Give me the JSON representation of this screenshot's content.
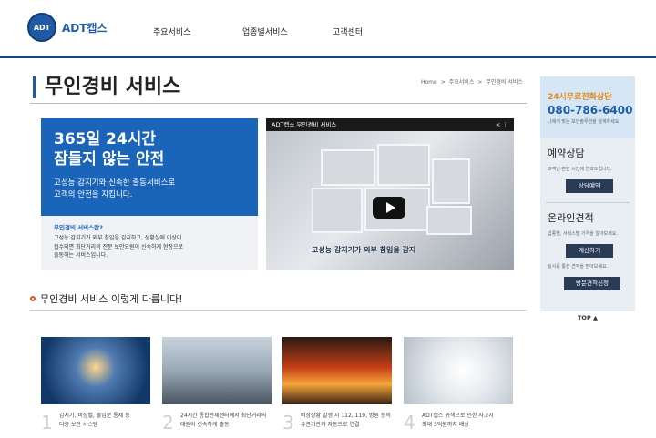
{
  "header": {
    "logo_badge": "ADT",
    "logo_text": "ADT캡스",
    "nav": [
      "주요서비스",
      "업종별서비스",
      "고객센터"
    ]
  },
  "page": {
    "title": "무인경비 서비스",
    "breadcrumb": [
      "Home",
      ">",
      "주요서비스",
      ">",
      "무인경비 서비스"
    ]
  },
  "promo": {
    "headline_line1": "365일 24시간",
    "headline_line2": "잠들지 않는 안전",
    "sub_line1": "고성능 감지기와 신속한 출동서비스로",
    "sub_line2": "고객의 안전을 지킵니다.",
    "question": "무인경비 서비스란?",
    "desc_line1": "고성능 감지기가 외부 침입을 감지하고, 상황실에 이상이",
    "desc_line2": "접수되면 최단거리의 전문 보안요원이 신속하게 현장으로",
    "desc_line3": "출동하는 서비스입니다."
  },
  "video": {
    "title": "ADT캡스 무인경비 서비스",
    "caption": "고성능 감지기가 외부 침입을 감지"
  },
  "section": {
    "title": "무인경비 서비스 이렇게 다릅니다!"
  },
  "features": [
    {
      "num": "1",
      "line1": "감지기, 비상벨, 출입문 통제 등",
      "line2": "다중 보안 시스템"
    },
    {
      "num": "2",
      "line1": "24시간 통합관제센터에서 최단거리의",
      "line2": "대원이 신속하게 출동"
    },
    {
      "num": "3",
      "line1": "비상상황 발생 시 112, 119, 병원 등의",
      "line2": "유관기관과 자동으로 연결"
    },
    {
      "num": "4",
      "line1": "ADT캡스 귀책으로 인한 사고시",
      "line2": "최대 3억원까지 배상"
    }
  ],
  "sidebar": {
    "free_call_label": "24시무료전화상담",
    "phone": "080-786-6400",
    "phone_note": "나에게 맞는 보안솔루션을 설계하세요",
    "consult_title": "예약상담",
    "consult_note": "고객님 편한 시간에 연락드립니다.",
    "consult_btn": "상담예약",
    "estimate_title": "온라인견적",
    "estimate_note": "업종별, 서비스별 가격을 알아보세요.",
    "estimate_btn": "계산하기",
    "visit_note": "실사를 통한 견적을 받아보세요.",
    "visit_btn": "방문견적신청",
    "top_btn": "TOP ▲"
  }
}
